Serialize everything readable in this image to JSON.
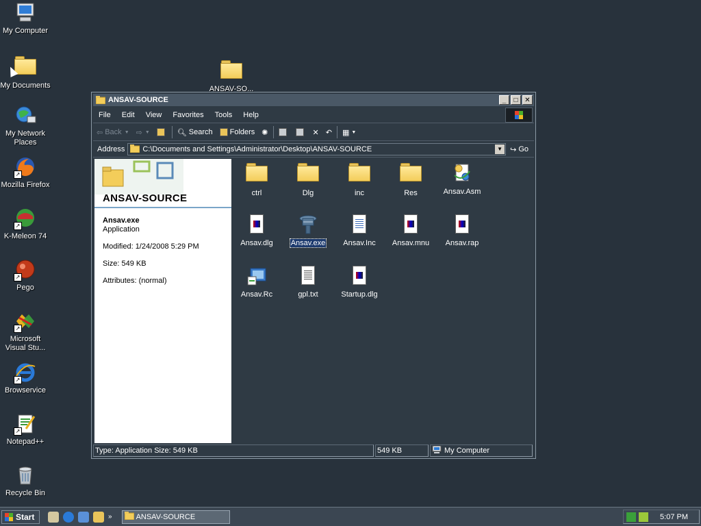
{
  "desktop": {
    "icons": [
      {
        "label": "My Computer"
      },
      {
        "label": "My Documents"
      },
      {
        "label": "My Network\nPlaces"
      },
      {
        "label": "Mozilla Firefox"
      },
      {
        "label": "K-Meleon 74"
      },
      {
        "label": "Pego"
      },
      {
        "label": "Microsoft\nVisual Stu..."
      },
      {
        "label": "Browservice"
      },
      {
        "label": "Notepad++"
      },
      {
        "label": "Recycle Bin"
      }
    ],
    "folder_icon_label": "ANSAV-SO..."
  },
  "window": {
    "title": "ANSAV-SOURCE",
    "menu": [
      "File",
      "Edit",
      "View",
      "Favorites",
      "Tools",
      "Help"
    ],
    "toolbar": {
      "back": "Back",
      "search": "Search",
      "folders": "Folders"
    },
    "address": {
      "label": "Address",
      "path": "C:\\Documents and Settings\\Administrator\\Desktop\\ANSAV-SOURCE",
      "go": "Go"
    },
    "taskpane": {
      "title": "ANSAV-SOURCE",
      "file_name": "Ansav.exe",
      "file_type": "Application",
      "modified": "Modified: 1/24/2008 5:29 PM",
      "size": "Size: 549 KB",
      "attributes": "Attributes: (normal)"
    },
    "files": [
      {
        "name": "ctrl",
        "kind": "folder"
      },
      {
        "name": "Dlg",
        "kind": "folder"
      },
      {
        "name": "inc",
        "kind": "folder"
      },
      {
        "name": "Res",
        "kind": "folder"
      },
      {
        "name": "Ansav.Asm",
        "kind": "asm"
      },
      {
        "name": "Ansav.dlg",
        "kind": "dlg"
      },
      {
        "name": "Ansav.exe",
        "kind": "exe",
        "selected": true
      },
      {
        "name": "Ansav.Inc",
        "kind": "doc"
      },
      {
        "name": "Ansav.mnu",
        "kind": "dlg"
      },
      {
        "name": "Ansav.rap",
        "kind": "dlg"
      },
      {
        "name": "Ansav.Rc",
        "kind": "rc"
      },
      {
        "name": "gpl.txt",
        "kind": "txt"
      },
      {
        "name": "Startup.dlg",
        "kind": "dlg"
      }
    ],
    "status": {
      "info": "Type: Application Size: 549 KB",
      "size": "549 KB",
      "zone": "My Computer"
    }
  },
  "taskbar": {
    "start": "Start",
    "task": "ANSAV-SOURCE",
    "clock": "5:07 PM"
  },
  "colors": {
    "desktop": "#28323c",
    "window": "#2f3a44",
    "selection": "#1c3a6e"
  }
}
